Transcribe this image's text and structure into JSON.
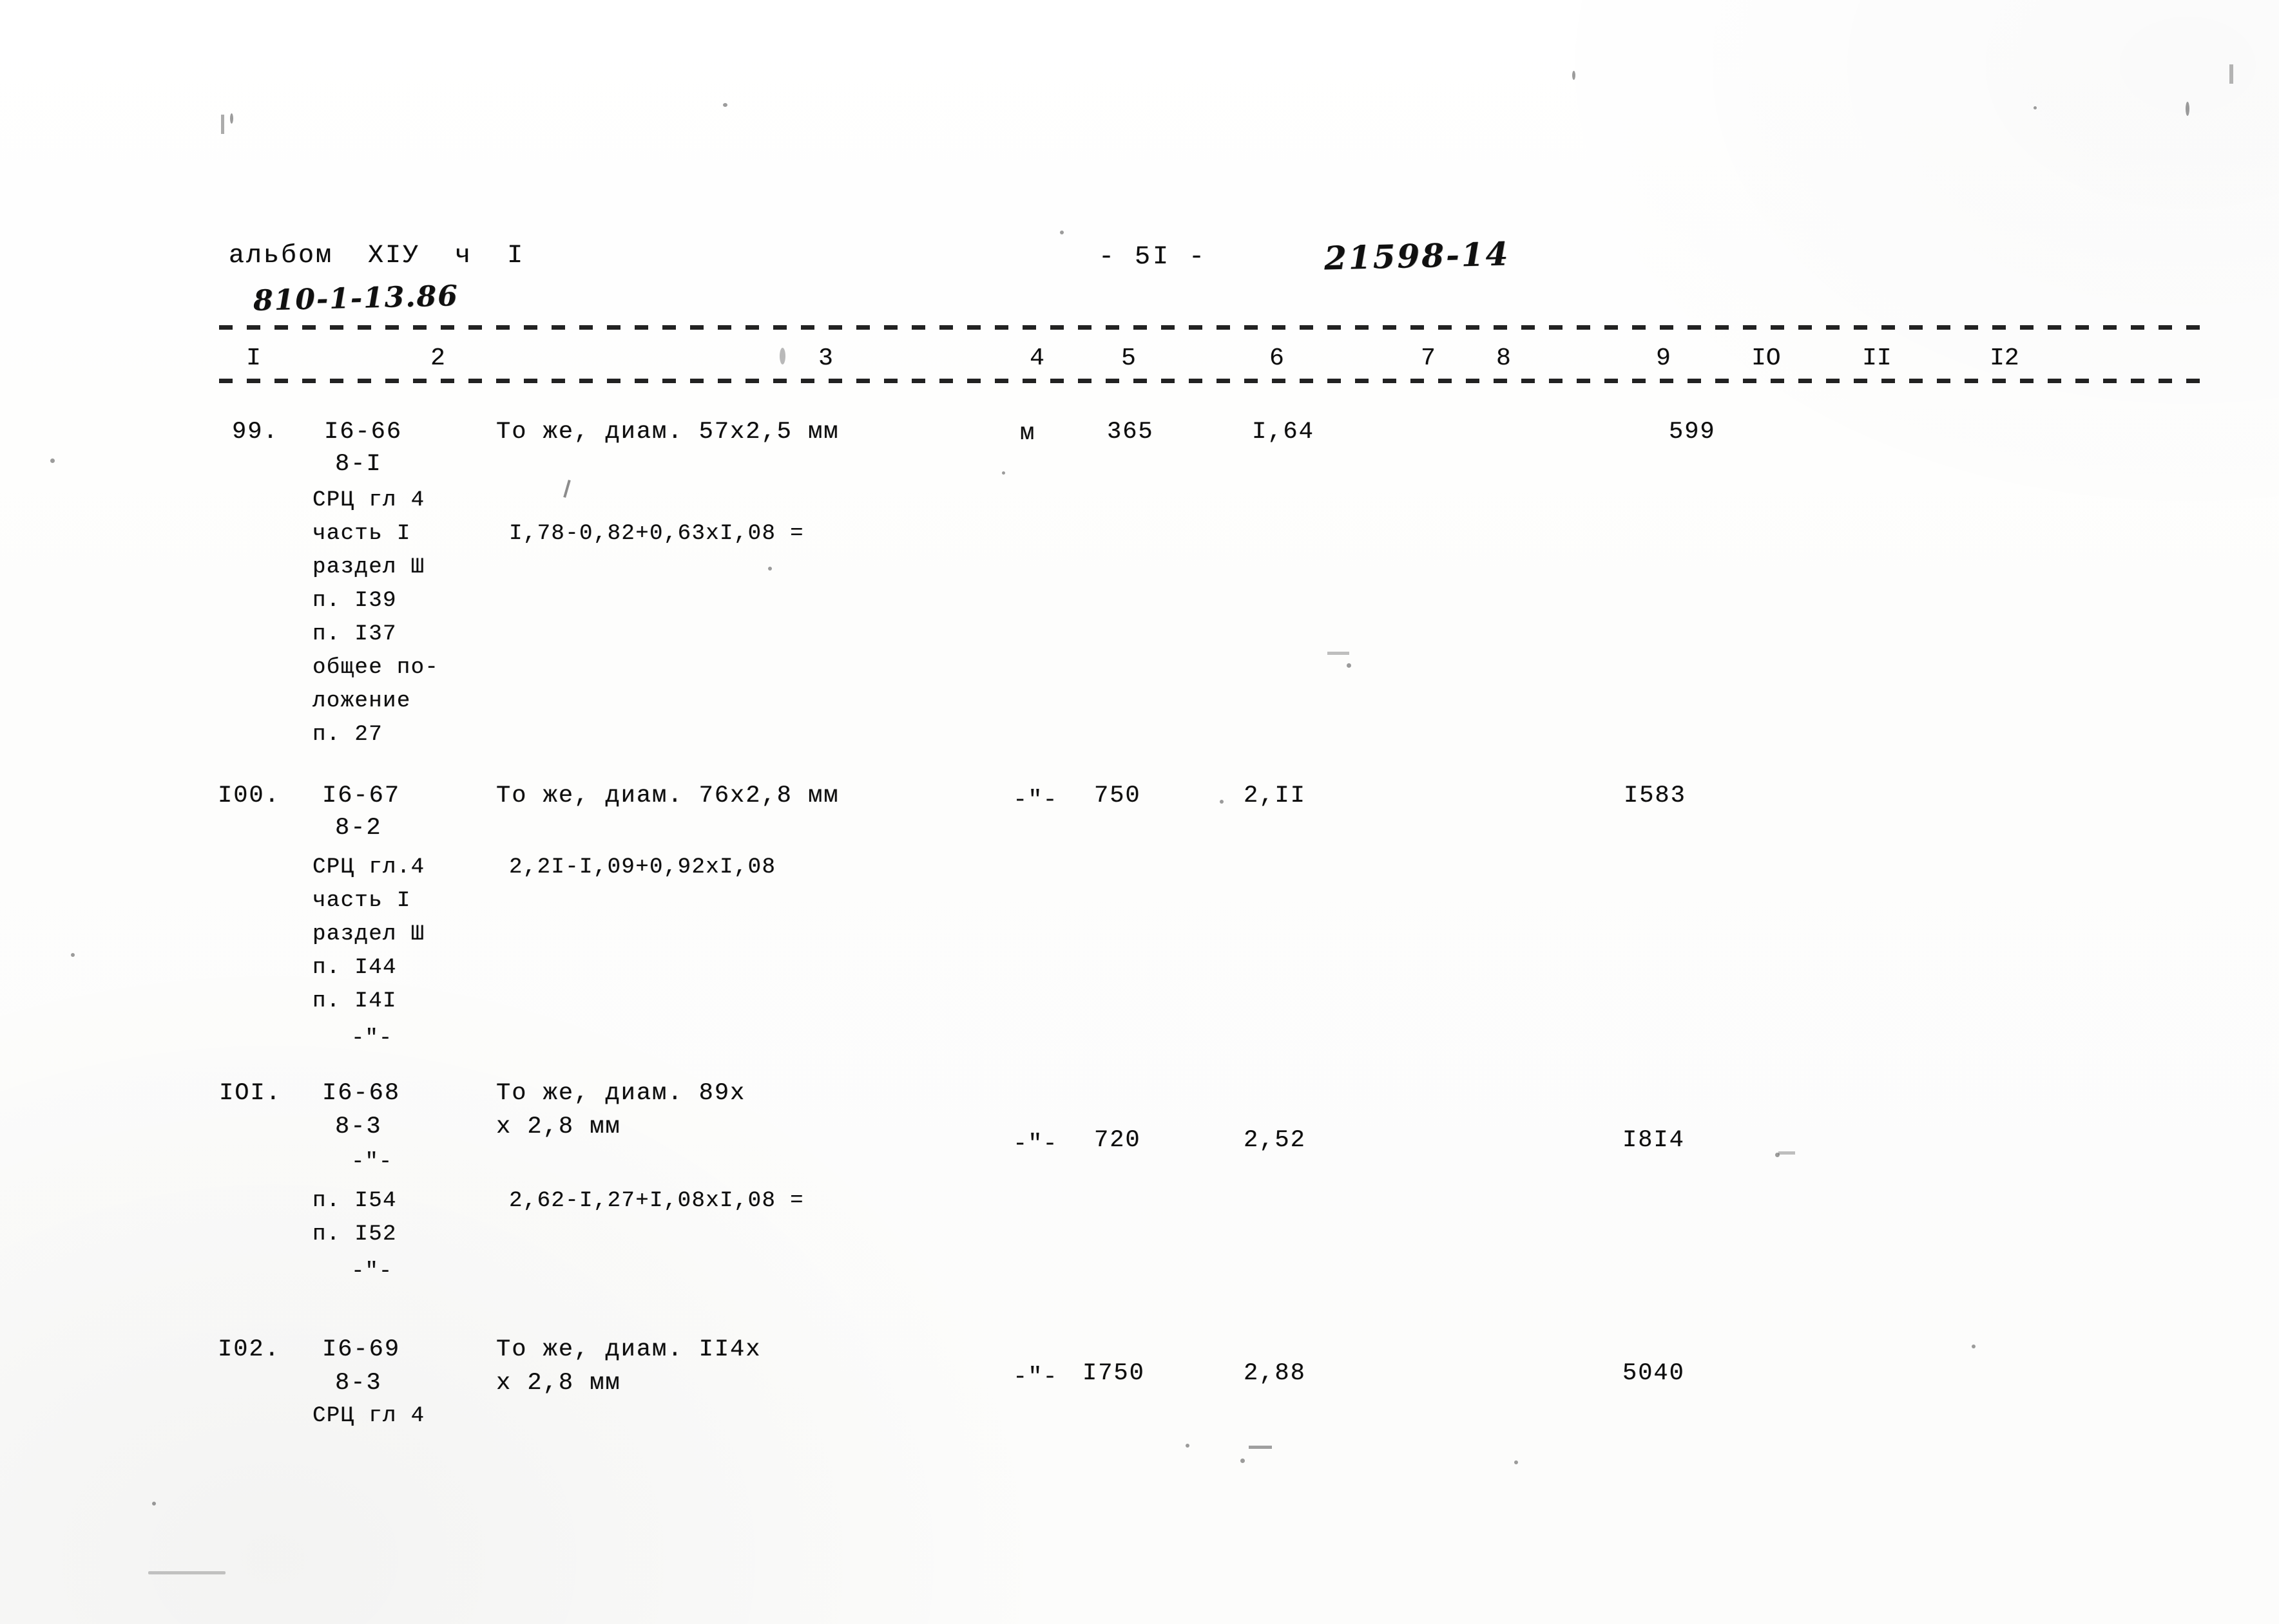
{
  "document": {
    "kind": "scanned-estimate-table-page",
    "header": {
      "album_line": "альбом  XIУ  ч  I",
      "album_code_handwritten": "810-1-13.86",
      "page_marker": "- 5I -",
      "archive_number_handwritten": "21598-14"
    },
    "column_header": {
      "numbers": [
        "I",
        "2",
        "3",
        "4",
        "5",
        "6",
        "7",
        "8",
        "9",
        "IO",
        "II",
        "I2"
      ]
    },
    "rows": [
      {
        "number": "99.",
        "code_top": "I6-66",
        "code_bottom": "8-I",
        "description": "То же, диам. 57х2,5 мм",
        "unit": "м",
        "quantity": "365",
        "price": "I,64",
        "total": "599",
        "notes": [
          "СРЦ гл 4",
          "часть I",
          "раздел Ш",
          "п. I39",
          "п. I37",
          "общее по-",
          "ложение",
          "п. 27"
        ],
        "formula": "I,78-0,82+0,63хI,08 ="
      },
      {
        "number": "I00.",
        "code_top": "I6-67",
        "code_bottom": "8-2",
        "description": "То же, диам. 76х2,8 мм",
        "unit": "-\"-",
        "quantity": "750",
        "price": "2,II",
        "total": "I583",
        "notes": [
          "СРЦ гл.4",
          "часть I",
          "раздел Ш",
          "п. I44",
          "п. I4I",
          "-\"-"
        ],
        "formula": "2,2I-I,09+0,92хI,08"
      },
      {
        "number": "IOI.",
        "code_top": "I6-68",
        "code_bottom": "8-3",
        "description_line1": "То же, диам. 89х",
        "description_line2": "х 2,8 мм",
        "unit": "-\"-",
        "quantity": "720",
        "price": "2,52",
        "total": "I8I4",
        "notes": [
          "-\"-",
          "п. I54",
          "п. I52",
          "-\"-"
        ],
        "formula": "2,62-I,27+I,08хI,08 ="
      },
      {
        "number": "I02.",
        "code_top": "I6-69",
        "code_bottom": "8-3",
        "description_line1": "То же, диам. II4х",
        "description_line2": "х 2,8 мм",
        "unit": "-\"-",
        "quantity": "I750",
        "price": "2,88",
        "total": "5040",
        "notes": [
          "СРЦ гл 4"
        ]
      }
    ]
  },
  "colors": {
    "ink": "#0d0d0d",
    "paper": "#fefefe",
    "rule": "#121212"
  }
}
